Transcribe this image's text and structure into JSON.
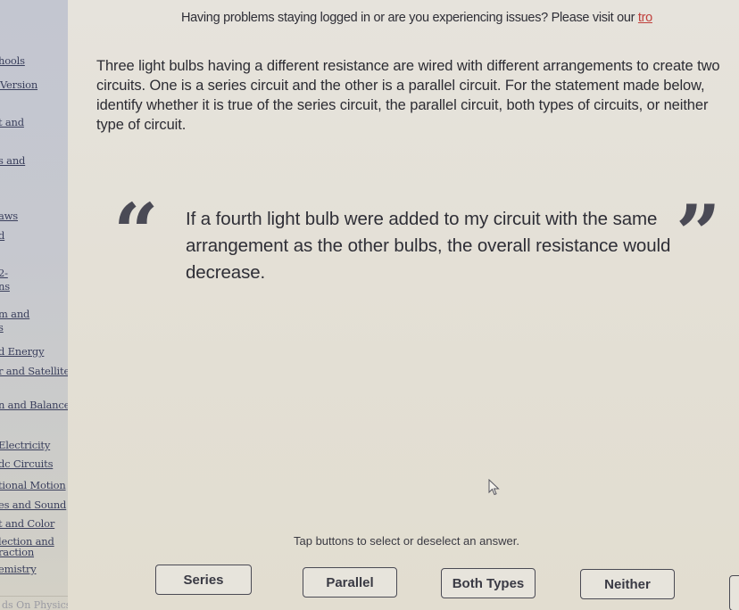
{
  "notice": {
    "text": "Having problems staying logged in or are you experiencing issues? Please visit our ",
    "link_text": "tro"
  },
  "sidebar": {
    "items": [
      {
        "label": "hools"
      },
      {
        "label": "Version"
      },
      {
        "label": "t and"
      },
      {
        "label": "s and"
      },
      {
        "label": "aws"
      },
      {
        "label": "d"
      },
      {
        "label": "2-"
      },
      {
        "label": "ns"
      },
      {
        "label": "m and"
      },
      {
        "label": "s"
      },
      {
        "label": "d Energy"
      },
      {
        "label": "r and Satellite"
      },
      {
        "label": "n and Balance"
      },
      {
        "label": "Electricity"
      },
      {
        "label": "dc Circuits"
      },
      {
        "label": "tional Motion"
      },
      {
        "label": "es and Sound"
      },
      {
        "label": "t and Color"
      },
      {
        "label": "lection and"
      },
      {
        "label": "raction"
      },
      {
        "label": "emistry"
      }
    ],
    "footer": "ds On Physics"
  },
  "question": {
    "instructions": "Three light bulbs having a different resistance are wired with different arrangements to create two circuits. One is a series circuit and the other is a parallel circuit. For the statement made below, identify whether it is true of the series circuit, the parallel circuit, both types of circuits, or neither type of circuit.",
    "open_quote": "“",
    "close_quote": "”",
    "statement": "If a fourth light bulb were added to my circuit with the same arrangement as the other bulbs, the overall resistance would decrease."
  },
  "answers": {
    "hint": "Tap buttons to select or deselect an answer.",
    "options": [
      {
        "label": "Series"
      },
      {
        "label": "Parallel"
      },
      {
        "label": "Both Types"
      },
      {
        "label": "Neither"
      }
    ]
  },
  "colors": {
    "link": "#c0403c",
    "sidebar_bg": "#c4c6cf",
    "page_bg": "#e4e0d6",
    "text": "#2e2e36"
  }
}
